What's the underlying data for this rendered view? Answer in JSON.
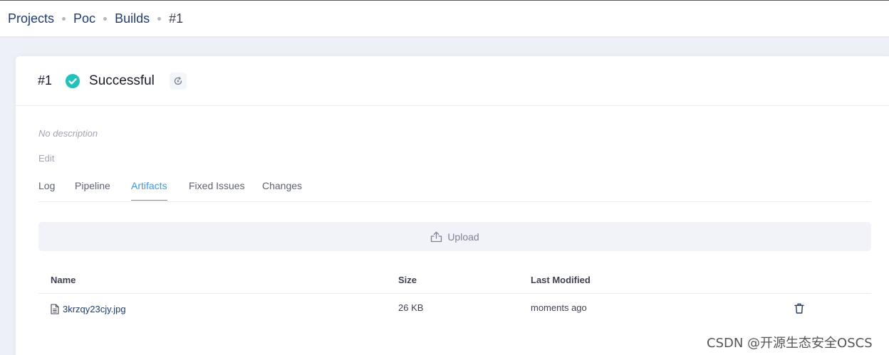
{
  "breadcrumb": {
    "items": [
      "Projects",
      "Poc",
      "Builds"
    ],
    "current": "#1"
  },
  "build": {
    "number": "#1",
    "status": "Successful",
    "status_color": "#1bc5bd",
    "description": "No description",
    "edit_label": "Edit"
  },
  "tabs": [
    {
      "label": "Log",
      "active": false
    },
    {
      "label": "Pipeline",
      "active": false
    },
    {
      "label": "Artifacts",
      "active": true
    },
    {
      "label": "Fixed Issues",
      "active": false
    },
    {
      "label": "Changes",
      "active": false
    }
  ],
  "upload": {
    "label": "Upload",
    "icon": "upload-icon"
  },
  "artifacts_table": {
    "columns": [
      "Name",
      "Size",
      "Last Modified"
    ],
    "rows": [
      {
        "name": "3krzqy23cjy.jpg",
        "size": "26 KB",
        "modified": "moments ago",
        "icon": "file-icon",
        "action_icon": "trash-icon"
      }
    ]
  },
  "watermark": "CSDN @开源生态安全OSCS",
  "colors": {
    "accent": "#3699ff",
    "link": "#1e3a78",
    "success": "#1bc5bd"
  }
}
